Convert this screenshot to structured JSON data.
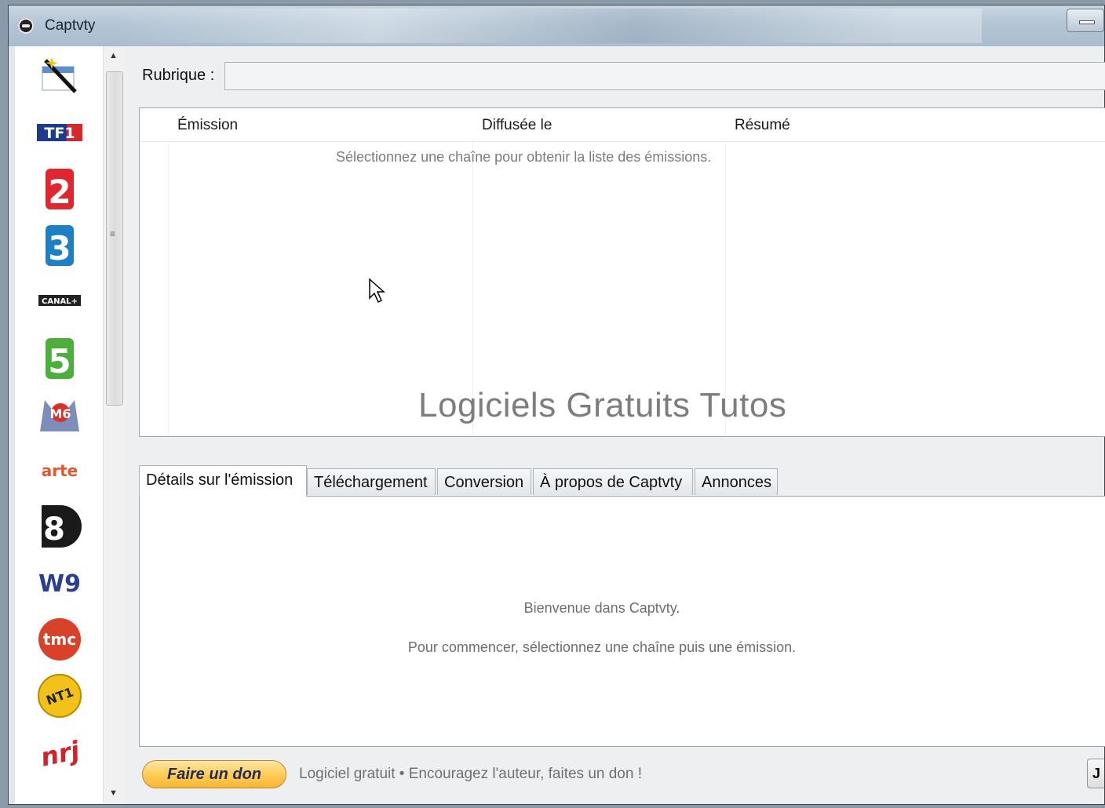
{
  "window": {
    "title": "Captvty"
  },
  "rubrique": {
    "label": "Rubrique :",
    "value": ""
  },
  "list": {
    "columns": [
      "Émission",
      "Diffusée le",
      "Résumé"
    ],
    "empty_message": "Sélectionnez une chaîne pour obtenir la liste des émissions.",
    "watermark": "Logiciels Gratuits Tutos"
  },
  "tabs": [
    {
      "label": "Détails sur l'émission",
      "active": true
    },
    {
      "label": "Téléchargement",
      "active": false
    },
    {
      "label": "Conversion",
      "active": false
    },
    {
      "label": "À propos de Captvty",
      "active": false
    },
    {
      "label": "Annonces",
      "active": false
    }
  ],
  "details": {
    "welcome": "Bienvenue dans Captvty.",
    "instructions": "Pour commencer, sélectionnez une chaîne puis une émission."
  },
  "footer": {
    "donate_label": "Faire un don",
    "text": "Logiciel gratuit  •  Encouragez l'auteur, faites un don !",
    "right_button_label": "J"
  },
  "channels": [
    {
      "name": "tools",
      "logo_text": "",
      "icon": "magic-wand-icon"
    },
    {
      "name": "tf1",
      "logo_text": "TF1",
      "color": "#1d3b8c"
    },
    {
      "name": "france-2",
      "logo_text": "2",
      "color": "#e0262e"
    },
    {
      "name": "france-3",
      "logo_text": "3",
      "color": "#1e7fc4"
    },
    {
      "name": "canal-plus",
      "logo_text": "CANAL+",
      "color": "#222222"
    },
    {
      "name": "france-5",
      "logo_text": "5",
      "color": "#4caf3c"
    },
    {
      "name": "m6",
      "logo_text": "M6",
      "color": "#d9302a"
    },
    {
      "name": "arte",
      "logo_text": "arte",
      "color": "#e2572c"
    },
    {
      "name": "d8",
      "logo_text": "8",
      "color": "#1a1a1a"
    },
    {
      "name": "w9",
      "logo_text": "W9",
      "color": "#2a3f8f"
    },
    {
      "name": "tmc",
      "logo_text": "tmc",
      "color": "#d8422b"
    },
    {
      "name": "nt1",
      "logo_text": "NT1",
      "color": "#f2c21a"
    },
    {
      "name": "nrj12",
      "logo_text": "nrj",
      "color": "#d2222a"
    }
  ]
}
